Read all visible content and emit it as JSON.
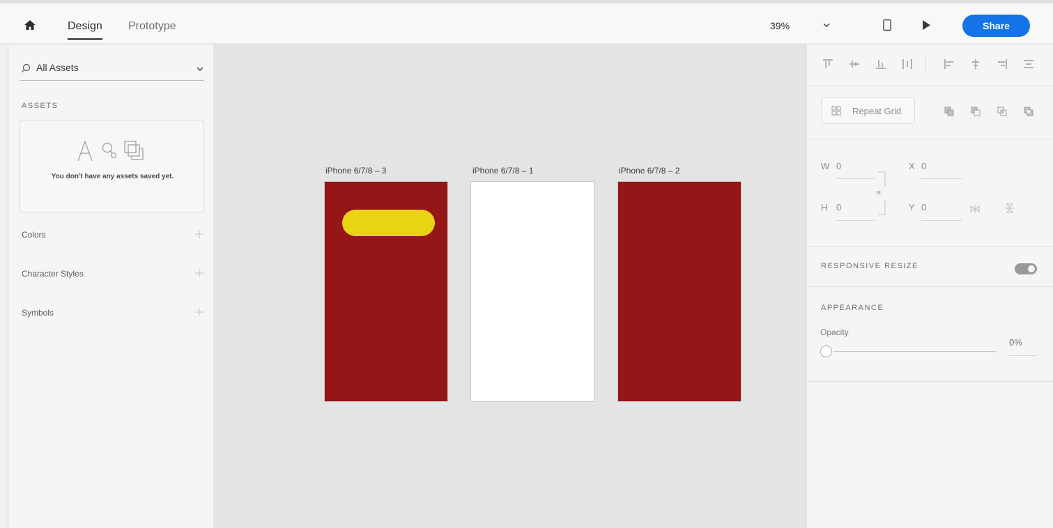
{
  "topbar": {
    "tabs": [
      {
        "label": "Design"
      },
      {
        "label": "Prototype"
      }
    ],
    "zoom": "39%",
    "share_label": "Share"
  },
  "left_panel": {
    "search_label": "All Assets",
    "assets_title": "ASSETS",
    "assets_empty": "You don't have any assets saved yet.",
    "sections": [
      {
        "label": "Colors"
      },
      {
        "label": "Character Styles"
      },
      {
        "label": "Symbols"
      }
    ]
  },
  "artboards": [
    {
      "label": "iPhone 6/7/8 – 3",
      "color": "#951616",
      "pill_color": "#e8d314"
    },
    {
      "label": "iPhone 6/7/8 – 1",
      "color": "#ffffff"
    },
    {
      "label": "iPhone 6/7/8 – 2",
      "color": "#951616"
    }
  ],
  "right_panel": {
    "repeat_grid": "Repeat Grid",
    "w_label": "W",
    "w_value": "0",
    "x_label": "X",
    "x_value": "0",
    "h_label": "H",
    "h_value": "0",
    "y_label": "Y",
    "y_value": "0",
    "responsive_resize": "RESPONSIVE RESIZE",
    "appearance": "APPEARANCE",
    "opacity_label": "Opacity",
    "opacity_value": "0%"
  },
  "colors": {
    "accent": "#1473e6"
  }
}
